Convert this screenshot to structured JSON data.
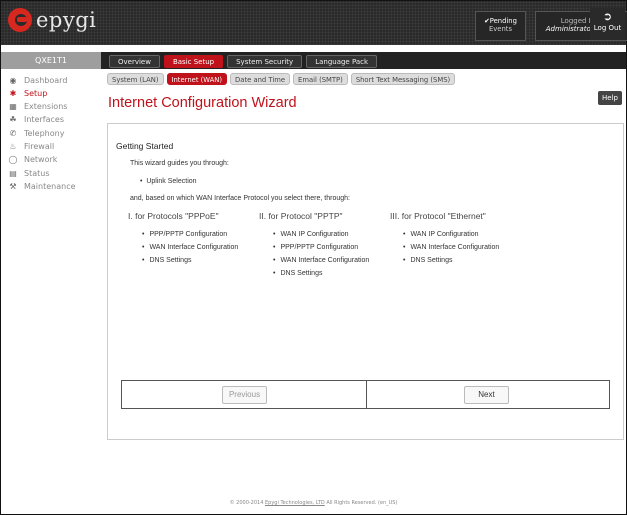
{
  "header": {
    "logo_text": "epygi",
    "pending": {
      "line1": "✔Pending",
      "line2": "Events"
    },
    "logged_in": {
      "label": "Logged In As:",
      "user": "Administrator (admin)"
    },
    "logout_label": "Log Out"
  },
  "device_name": "QXE1T1",
  "main_tabs": [
    {
      "label": "Overview"
    },
    {
      "label": "Basic Setup"
    },
    {
      "label": "System Security"
    },
    {
      "label": "Language Pack"
    }
  ],
  "sub_tabs": [
    {
      "label": "System (LAN)"
    },
    {
      "label": "Internet (WAN)"
    },
    {
      "label": "Date and Time"
    },
    {
      "label": "Email (SMTP)"
    },
    {
      "label": "Short Text Messaging (SMS)"
    }
  ],
  "sidebar": {
    "items": [
      {
        "label": "Dashboard",
        "icon": "dashboard-icon"
      },
      {
        "label": "Setup",
        "icon": "gear-icon"
      },
      {
        "label": "Extensions",
        "icon": "phone-icon"
      },
      {
        "label": "Interfaces",
        "icon": "interfaces-icon"
      },
      {
        "label": "Telephony",
        "icon": "handset-icon"
      },
      {
        "label": "Firewall",
        "icon": "flame-icon"
      },
      {
        "label": "Network",
        "icon": "globe-icon"
      },
      {
        "label": "Status",
        "icon": "bar-chart-icon"
      },
      {
        "label": "Maintenance",
        "icon": "wrench-icon"
      }
    ]
  },
  "page": {
    "title": "Internet Configuration Wizard",
    "help_label": "Help",
    "getting_started": "Getting Started",
    "intro": "This wizard guides you through:",
    "uplink": "Uplink Selection",
    "based_on": "and, based on which WAN Interface Protocol you select there, through:",
    "columns": [
      {
        "heading": "I. for Protocols \"PPPoE\"",
        "items": [
          "PPP/PPTP Configuration",
          "WAN Interface Configuration",
          "DNS Settings"
        ]
      },
      {
        "heading": "II. for Protocol \"PPTP\"",
        "items": [
          "WAN IP Configuration",
          "PPP/PPTP Configuration",
          "WAN Interface Configuration",
          "DNS Settings"
        ]
      },
      {
        "heading": "III. for Protocol \"Ethernet\"",
        "items": [
          "WAN IP Configuration",
          "WAN Interface Configuration",
          "DNS Settings"
        ]
      }
    ],
    "previous_label": "Previous",
    "next_label": "Next"
  },
  "footer": {
    "pre": "© 2000-2014 ",
    "link": "Epygi Technologies, LTD",
    "post": " All Rights Reserved. (en_US)"
  },
  "colors": {
    "accent": "#c0121b",
    "header_bg": "#2a2a2a"
  }
}
